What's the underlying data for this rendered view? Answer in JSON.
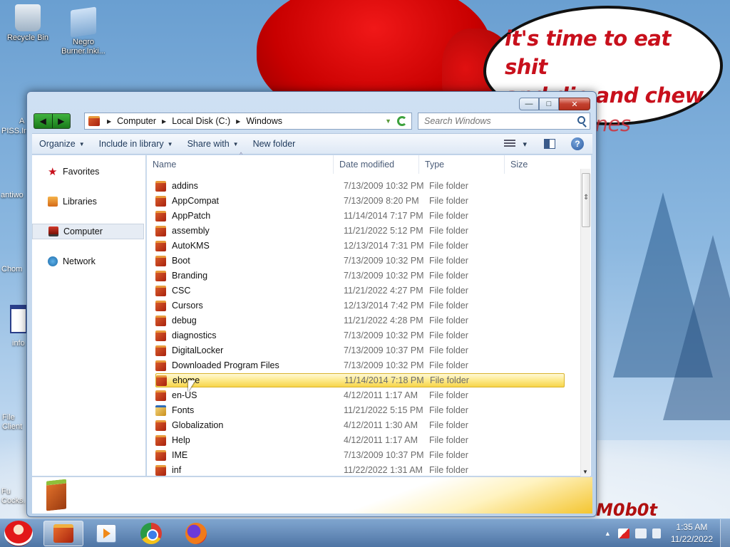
{
  "desktop": {
    "icons": [
      {
        "label": "Recycle Bin",
        "icon": "recycle-bin-icon"
      },
      {
        "label": "Negro Burner.Inki...",
        "icon": "document-icon"
      }
    ],
    "edge_labels": [
      "A",
      "PISS.In",
      "antiwo",
      "Chom",
      "info",
      "File Client",
      "Fu Cocks."
    ],
    "bubble_lines": [
      "it's time to eat shit",
      "and die and chew",
      "candy canes"
    ],
    "signature": "M0b0t"
  },
  "window": {
    "caption_buttons": {
      "minimize": "—",
      "maximize": "□",
      "close": "✕"
    },
    "nav": {
      "back": "◀",
      "forward": "▶",
      "recent": "▼"
    },
    "address": {
      "crumbs": [
        "Computer",
        "Local Disk (C:)",
        "Windows"
      ]
    },
    "search": {
      "placeholder": "Search Windows"
    },
    "toolbar": {
      "organize": "Organize",
      "include_in_library": "Include in library",
      "share_with": "Share with",
      "new_folder": "New folder",
      "views_arrow": "▾",
      "help": "?"
    },
    "nav_pane": [
      {
        "label": "Favorites",
        "icon": "star-icon"
      },
      {
        "label": "Libraries",
        "icon": "libraries-icon"
      },
      {
        "label": "Computer",
        "icon": "computer-icon",
        "selected": true
      },
      {
        "label": "Network",
        "icon": "network-icon"
      }
    ],
    "columns": {
      "name": "Name",
      "date": "Date modified",
      "type": "Type",
      "size": "Size"
    },
    "files": [
      {
        "name": "addins",
        "date": "7/13/2009 10:32 PM",
        "type": "File folder"
      },
      {
        "name": "AppCompat",
        "date": "7/13/2009 8:20 PM",
        "type": "File folder"
      },
      {
        "name": "AppPatch",
        "date": "11/14/2014 7:17 PM",
        "type": "File folder"
      },
      {
        "name": "assembly",
        "date": "11/21/2022 5:12 PM",
        "type": "File folder"
      },
      {
        "name": "AutoKMS",
        "date": "12/13/2014 7:31 PM",
        "type": "File folder"
      },
      {
        "name": "Boot",
        "date": "7/13/2009 10:32 PM",
        "type": "File folder"
      },
      {
        "name": "Branding",
        "date": "7/13/2009 10:32 PM",
        "type": "File folder"
      },
      {
        "name": "CSC",
        "date": "11/21/2022 4:27 PM",
        "type": "File folder"
      },
      {
        "name": "Cursors",
        "date": "12/13/2014 7:42 PM",
        "type": "File folder"
      },
      {
        "name": "debug",
        "date": "11/21/2022 4:28 PM",
        "type": "File folder"
      },
      {
        "name": "diagnostics",
        "date": "7/13/2009 10:32 PM",
        "type": "File folder"
      },
      {
        "name": "DigitalLocker",
        "date": "7/13/2009 10:37 PM",
        "type": "File folder"
      },
      {
        "name": "Downloaded Program Files",
        "date": "7/13/2009 10:32 PM",
        "type": "File folder"
      },
      {
        "name": "ehome",
        "date": "11/14/2014 7:18 PM",
        "type": "File folder",
        "selected": true
      },
      {
        "name": "en-US",
        "date": "4/12/2011 1:17 AM",
        "type": "File folder"
      },
      {
        "name": "Fonts",
        "date": "11/21/2022 5:15 PM",
        "type": "File folder"
      },
      {
        "name": "Globalization",
        "date": "4/12/2011 1:30 AM",
        "type": "File folder"
      },
      {
        "name": "Help",
        "date": "4/12/2011 1:17 AM",
        "type": "File folder"
      },
      {
        "name": "IME",
        "date": "7/13/2009 10:37 PM",
        "type": "File folder"
      },
      {
        "name": "inf",
        "date": "11/22/2022 1:31 AM",
        "type": "File folder"
      }
    ]
  },
  "taskbar": {
    "pinned": [
      "explorer-icon",
      "media-player-icon",
      "chrome-icon",
      "firefox-icon"
    ],
    "clock": {
      "time": "1:35 AM",
      "date": "11/22/2022"
    },
    "tray_up": "▲"
  }
}
